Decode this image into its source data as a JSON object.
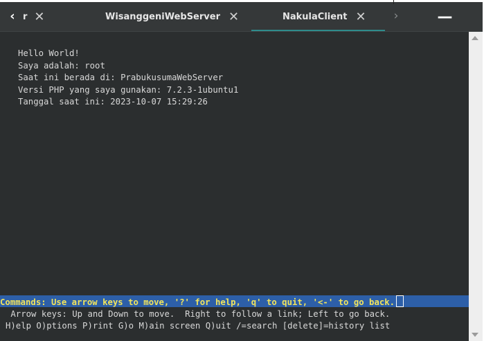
{
  "tabs": [
    {
      "label": "r",
      "close_glyph": "✕"
    },
    {
      "label": "WisanggeniWebServer",
      "close_glyph": "✕"
    },
    {
      "label": "NakulaClient",
      "close_glyph": "✕",
      "active": true
    }
  ],
  "nav": {
    "scroll_left_glyph": "‹",
    "scroll_right_glyph": "›",
    "minimize_glyph": "—"
  },
  "terminal": {
    "output_lines": [
      "Hello World!",
      "Saya adalah: root",
      "Saat ini berada di: PrabukusumaWebServer",
      "Versi PHP yang saya gunakan: 7.2.3-1ubuntu1",
      "Tanggal saat ini: 2023-10-07 15:29:26"
    ],
    "command_bar": "Commands: Use arrow keys to move, '?' for help, 'q' to quit, '<-' to go back.",
    "help_line_1": " Arrow keys: Up and Down to move.  Right to follow a link; Left to go back.",
    "help_line_2": "H)elp O)ptions P)rint G)o M)ain screen Q)uit /=search [delete]=history list"
  },
  "colors": {
    "terminal_bg": "#2b2e2f",
    "tabbar_bg": "#353839",
    "active_tab_accent": "#2f8c8c",
    "command_bar_bg": "#2d5fa8",
    "command_bar_text": "#f2e45c"
  }
}
